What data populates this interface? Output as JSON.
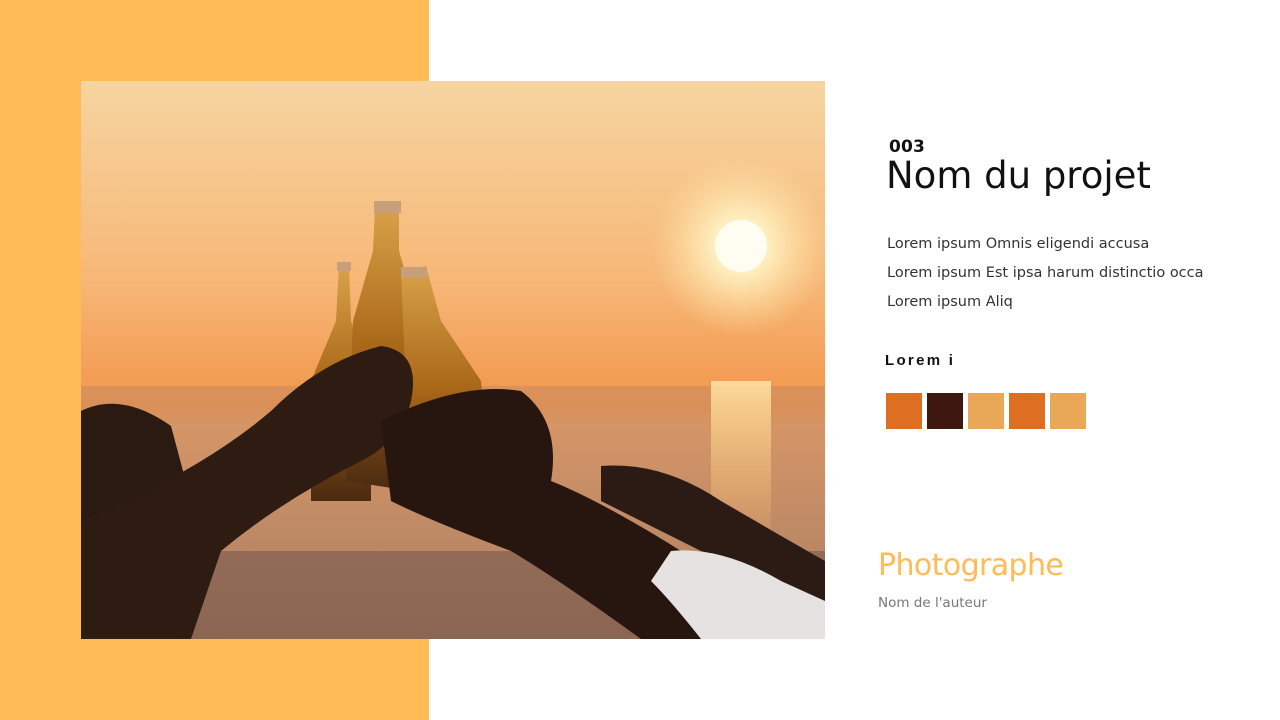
{
  "slide": {
    "accent_color": "#FFBB55",
    "photo": {
      "icon": "photo-image",
      "subject": "beer-bottles-toast-sunset"
    },
    "project": {
      "number": "003",
      "title": "Nom du projet",
      "description_lines": [
        "Lorem ipsum Omnis eligendi accusa",
        "Lorem ipsum Est ipsa harum distinctio occa",
        "Lorem ipsum Aliq"
      ]
    },
    "palette": {
      "title": "Lorem i",
      "colors": [
        "#DD6E22",
        "#3E1710",
        "#E8A858",
        "#DD6E22",
        "#E8A858"
      ]
    },
    "credits": {
      "label": "Photographe",
      "author": "Nom de l'auteur"
    }
  }
}
